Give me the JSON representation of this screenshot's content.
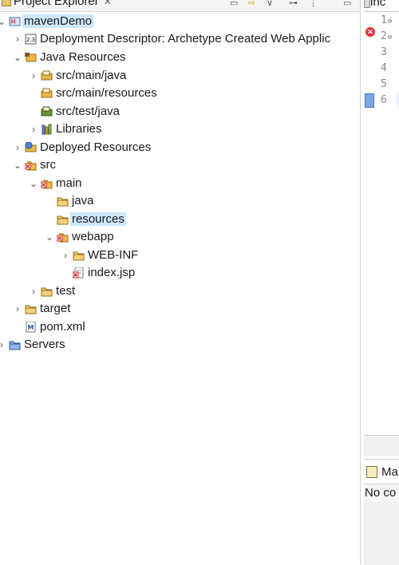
{
  "explorer": {
    "title": "Project Explorer",
    "close_glyph": "✕",
    "toolbar_icons": [
      "collapse-all-icon",
      "link-with-editor-icon",
      "filters-icon",
      "focus-icon",
      "view-menu-icon"
    ]
  },
  "tree": [
    {
      "label": "mavenDemo",
      "icon": "maven-project-icon",
      "expanded": true,
      "selected": true
    },
    {
      "label": "Deployment Descriptor: Archetype Created Web Applic",
      "icon": "deployment-descriptor-icon",
      "expanded": false
    },
    {
      "label": "Java Resources",
      "icon": "java-resources-icon",
      "expanded": true
    },
    {
      "label": "src/main/java",
      "icon": "source-folder-icon",
      "expanded": false
    },
    {
      "label": "src/main/resources",
      "icon": "source-folder-icon"
    },
    {
      "label": "src/test/java",
      "icon": "test-source-folder-icon"
    },
    {
      "label": "Libraries",
      "icon": "libraries-icon",
      "expanded": false
    },
    {
      "label": "Deployed Resources",
      "icon": "deployed-resources-icon",
      "expanded": false
    },
    {
      "label": "src",
      "icon": "error-folder-icon",
      "expanded": true
    },
    {
      "label": "main",
      "icon": "error-folder-icon",
      "expanded": true
    },
    {
      "label": "java",
      "icon": "folder-icon"
    },
    {
      "label": "resources",
      "icon": "folder-icon",
      "highlighted": true
    },
    {
      "label": "webapp",
      "icon": "error-folder-icon",
      "expanded": true
    },
    {
      "label": "WEB-INF",
      "icon": "folder-icon",
      "expanded": false
    },
    {
      "label": "index.jsp",
      "icon": "jsp-error-file-icon"
    },
    {
      "label": "test",
      "icon": "folder-icon",
      "expanded": false
    },
    {
      "label": "target",
      "icon": "folder-icon",
      "expanded": false
    },
    {
      "label": "pom.xml",
      "icon": "pom-file-icon"
    },
    {
      "label": "Servers",
      "icon": "servers-folder-icon",
      "expanded": false
    }
  ],
  "editor": {
    "tab_label": "inc",
    "line_numbers": [
      "1",
      "2",
      "3",
      "4",
      "5",
      "6"
    ],
    "current_line": "6"
  },
  "bottom_pane": {
    "tab_label": "Ma",
    "content": "No co"
  },
  "colors": {
    "selection": "#cce8ff",
    "folder": "#e9b84a",
    "error": "#d33333"
  }
}
